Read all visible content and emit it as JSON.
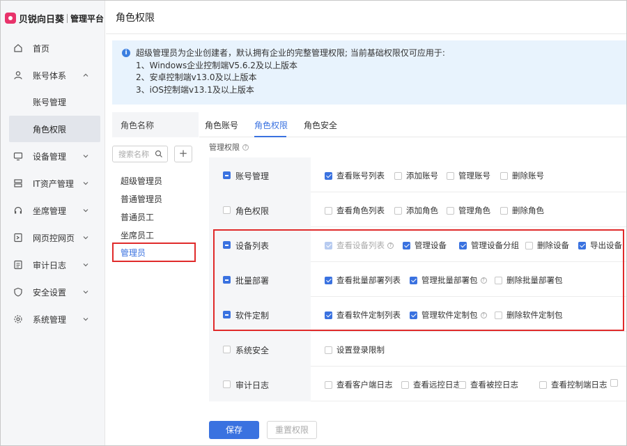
{
  "brand": {
    "name": "贝锐向日葵",
    "subtitle": "管理平台"
  },
  "sidebar": {
    "items": [
      {
        "label": "首页",
        "icon": "home-icon"
      },
      {
        "label": "账号体系",
        "icon": "user-icon",
        "expanded": true,
        "children": [
          {
            "label": "账号管理"
          },
          {
            "label": "角色权限",
            "active": true
          }
        ]
      },
      {
        "label": "设备管理",
        "icon": "monitor-icon"
      },
      {
        "label": "IT资产管理",
        "icon": "server-icon"
      },
      {
        "label": "坐席管理",
        "icon": "headset-icon"
      },
      {
        "label": "网页控网页",
        "icon": "web-control-icon"
      },
      {
        "label": "审计日志",
        "icon": "log-icon"
      },
      {
        "label": "安全设置",
        "icon": "shield-icon"
      },
      {
        "label": "系统管理",
        "icon": "gear-icon"
      }
    ]
  },
  "header": {
    "title": "角色权限"
  },
  "notice": {
    "title": "超级管理员为企业创建者，默认拥有企业的完整管理权限; 当前基础权限仅可应用于:",
    "lines": [
      "1、Windows企业控制端V5.6.2及以上版本",
      "2、安卓控制端v13.0及以上版本",
      "3、iOS控制端v13.1及以上版本"
    ]
  },
  "roles": {
    "header": "角色名称",
    "search_placeholder": "搜索名称",
    "add_label": "+",
    "items": [
      {
        "label": "超级管理员"
      },
      {
        "label": "普通管理员"
      },
      {
        "label": "普通员工"
      },
      {
        "label": "坐席员工"
      },
      {
        "label": "管理员",
        "selected": true
      }
    ]
  },
  "tabs": [
    {
      "label": "角色账号"
    },
    {
      "label": "角色权限",
      "active": true
    },
    {
      "label": "角色安全"
    }
  ],
  "permissions": {
    "label": "管理权限",
    "modules": [
      {
        "name": "账号管理",
        "state": "indeterminate",
        "perms": [
          {
            "label": "查看账号列表",
            "checked": true
          },
          {
            "label": "添加账号",
            "checked": false
          },
          {
            "label": "管理账号",
            "checked": false
          },
          {
            "label": "删除账号",
            "checked": false
          }
        ]
      },
      {
        "name": "角色权限",
        "state": "unchecked",
        "perms": [
          {
            "label": "查看角色列表",
            "checked": false
          },
          {
            "label": "添加角色",
            "checked": false
          },
          {
            "label": "管理角色",
            "checked": false
          },
          {
            "label": "删除角色",
            "checked": false
          }
        ]
      },
      {
        "name": "设备列表",
        "state": "indeterminate",
        "perms": [
          {
            "label": "查看设备列表",
            "checked": true,
            "disabled": true,
            "help": true
          },
          {
            "label": "管理设备",
            "checked": true
          },
          {
            "label": "管理设备分组",
            "checked": true
          },
          {
            "label": "删除设备",
            "checked": false
          },
          {
            "label": "导出设备",
            "checked": true
          }
        ]
      },
      {
        "name": "批量部署",
        "state": "indeterminate",
        "perms": [
          {
            "label": "查看批量部署列表",
            "checked": true
          },
          {
            "label": "管理批量部署包",
            "checked": true,
            "help": true
          },
          {
            "label": "删除批量部署包",
            "checked": false
          }
        ]
      },
      {
        "name": "软件定制",
        "state": "indeterminate",
        "perms": [
          {
            "label": "查看软件定制列表",
            "checked": true
          },
          {
            "label": "管理软件定制包",
            "checked": true,
            "help": true
          },
          {
            "label": "删除软件定制包",
            "checked": false
          }
        ]
      },
      {
        "name": "系统安全",
        "state": "unchecked",
        "perms": [
          {
            "label": "设置登录限制",
            "checked": false
          }
        ]
      },
      {
        "name": "审计日志",
        "state": "unchecked",
        "perms": [
          {
            "label": "查看客户端日志",
            "checked": false
          },
          {
            "label": "查看远控日志",
            "checked": false
          },
          {
            "label": "查看被控日志",
            "checked": false
          },
          {
            "label": "查看控制端日志",
            "checked": false
          },
          {
            "label": "",
            "checked": false
          }
        ]
      }
    ]
  },
  "actions": {
    "save": "保存",
    "reset": "重置权限"
  },
  "colors": {
    "primary": "#3a72e0",
    "highlight": "#e02a2a",
    "brand": "#e8336b",
    "notice_bg": "#e8f3fd"
  }
}
